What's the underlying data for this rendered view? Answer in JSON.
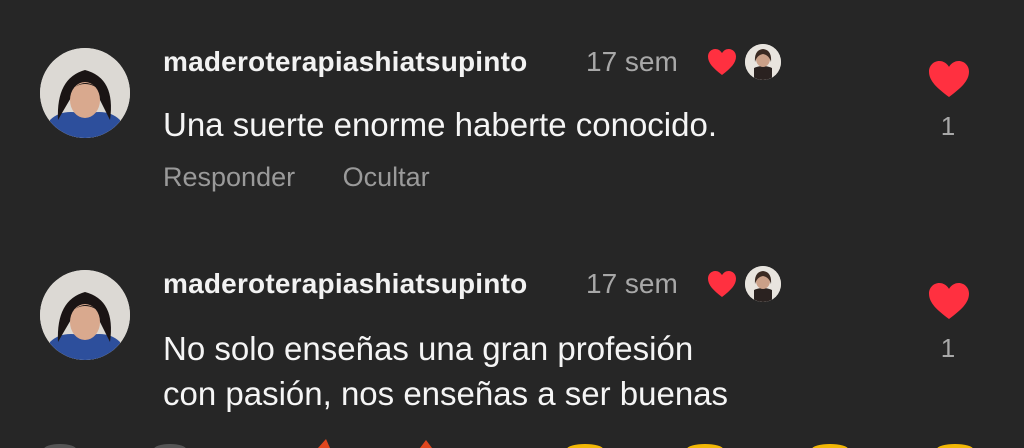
{
  "comments": [
    {
      "username": "maderoterapiashiatsupinto",
      "time": "17 sem",
      "text_lines": [
        "Una suerte enorme haberte conocido."
      ],
      "actions": {
        "reply": "Responder",
        "hide": "Ocultar"
      },
      "like_count": "1",
      "liked_by_creator": true
    },
    {
      "username": "maderoterapiashiatsupinto",
      "time": "17 sem",
      "text_lines": [
        "No solo enseñas una gran profesión",
        "con pasión,  nos enseñas a ser buenas"
      ],
      "like_count": "1",
      "liked_by_creator": true
    }
  ],
  "icons": {
    "creator_heart": "heart-filled-icon",
    "like_heart": "heart-filled-icon"
  },
  "colors": {
    "background": "#262626",
    "heart": "#ff3040",
    "username": "#f2f2f2",
    "secondary_text": "#a8a8a8"
  }
}
